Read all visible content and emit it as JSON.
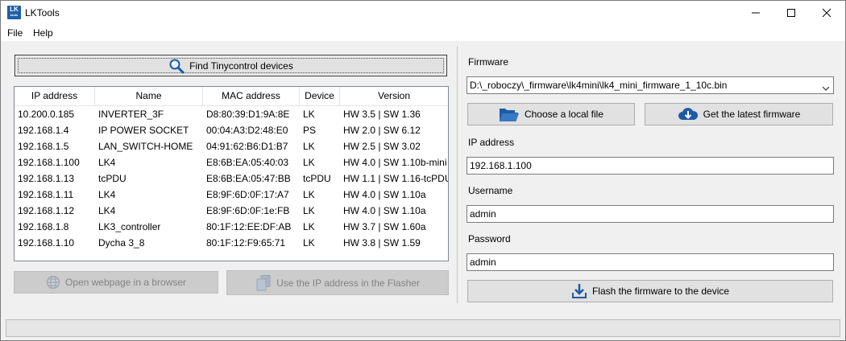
{
  "window": {
    "title": "LKTools",
    "icon_text": "LK",
    "icon_subtext": "tools",
    "icon_name": "lktools-app-icon"
  },
  "menu": {
    "items": [
      "File",
      "Help"
    ]
  },
  "left": {
    "find_button": {
      "label": "Find Tinycontrol devices",
      "icon": "search-icon"
    },
    "columns": [
      "IP address",
      "Name",
      "MAC address",
      "Device",
      "Version"
    ],
    "rows": [
      [
        "10.200.0.185",
        "INVERTER_3F",
        "D8:80:39:D1:9A:8E",
        "LK",
        "HW 3.5 | SW 1.36"
      ],
      [
        "192.168.1.4",
        "IP POWER SOCKET",
        "00:04:A3:D2:48:E0",
        "PS",
        "HW 2.0 | SW 6.12"
      ],
      [
        "192.168.1.5",
        "LAN_SWITCH-HOME",
        "04:91:62:B6:D1:B7",
        "LK",
        "HW 2.5 | SW 3.02"
      ],
      [
        "192.168.1.100",
        "LK4",
        "E8:6B:EA:05:40:03",
        "LK",
        "HW 4.0 | SW 1.10b-mini"
      ],
      [
        "192.168.1.13",
        "tcPDU",
        "E8:6B:EA:05:47:BB",
        "tcPDU",
        "HW 1.1 | SW 1.16-tcPDU"
      ],
      [
        "192.168.1.11",
        "LK4",
        "E8:9F:6D:0F:17:A7",
        "LK",
        "HW 4.0 | SW 1.10a"
      ],
      [
        "192.168.1.12",
        "LK4",
        "E8:9F:6D:0F:1e:FB",
        "LK",
        "HW 4.0 | SW 1.10a"
      ],
      [
        "192.168.1.8",
        "LK3_controller",
        "80:1F:12:EE:DF:AB",
        "LK",
        "HW 3.7 | SW 1.60a"
      ],
      [
        "192.168.1.10",
        "Dycha 3_8",
        "80:1F:12:F9:65:71",
        "LK",
        "HW 3.8 | SW 1.59"
      ]
    ],
    "open_browser_button": {
      "label": "Open webpage in a browser",
      "icon": "globe-icon"
    },
    "use_ip_button": {
      "label": "Use the IP address in the Flasher",
      "icon": "copy-icon"
    }
  },
  "right": {
    "firmware_label": "Firmware",
    "firmware_path": "D:\\_roboczy\\_firmware\\lk4mini\\lk4_mini_firmware_1_10c.bin",
    "choose_file_button": {
      "label": "Choose a local file",
      "icon": "folder-open-icon"
    },
    "latest_firmware_button": {
      "label": "Get the latest firmware",
      "icon": "cloud-download-icon"
    },
    "ip_label": "IP address",
    "ip_value": "192.168.1.100",
    "username_label": "Username",
    "username_value": "admin",
    "password_label": "Password",
    "password_value": "admin",
    "flash_button": {
      "label": "Flash the firmware to the device",
      "icon": "download-icon"
    }
  },
  "colors": {
    "accent": "#1f5fa6",
    "icon_blue": "#1c5aa6",
    "disabled_text": "#838383"
  }
}
